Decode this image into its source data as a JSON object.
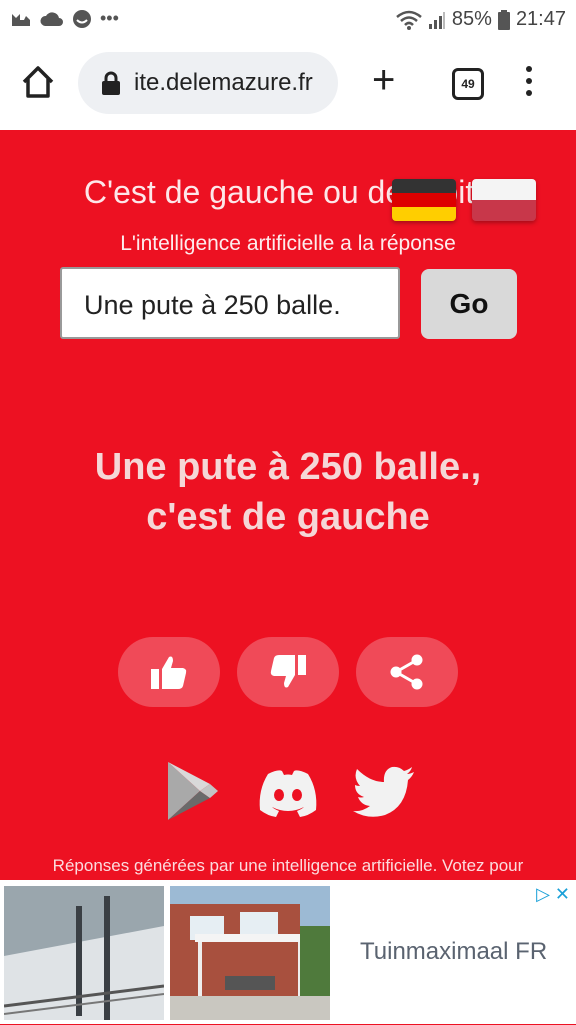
{
  "status_bar": {
    "notifications": [
      "cat-icon",
      "cloud-icon",
      "smiley-icon",
      "more-dots"
    ],
    "battery": "85%",
    "time": "21:47"
  },
  "browser": {
    "url": "ite.delemazure.fr",
    "tab_count": "49"
  },
  "page": {
    "title": "C'est de gauche ou de droite",
    "subtitle": "L'intelligence artificielle a la réponse",
    "query_value": "Une pute à 250 balle.",
    "go_label": "Go",
    "answer_line1": "Une pute à 250 balle.,",
    "answer_line2": "c'est de gauche",
    "disclaimer": "Réponses générées par une intelligence artificielle. Votez pour"
  },
  "ad": {
    "advertiser": "Tuinmaximaal FR"
  },
  "colors": {
    "page_bg": "#ed1122",
    "vote_button_bg": "#f04a58"
  }
}
